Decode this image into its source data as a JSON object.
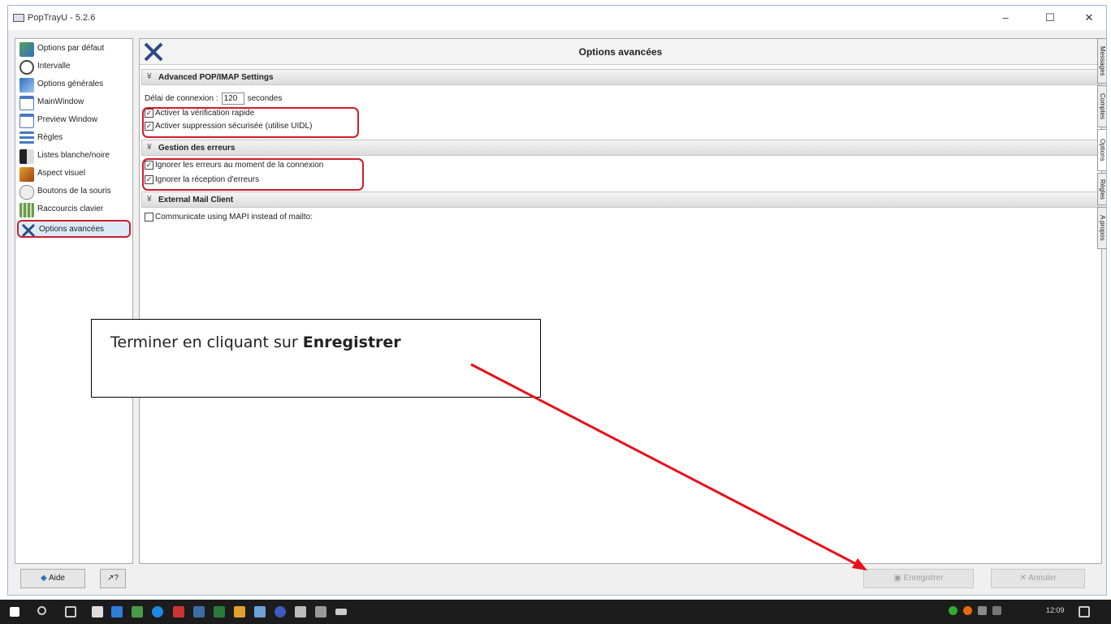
{
  "window": {
    "title": "PopTrayU - 5.2.6",
    "minimize": "–",
    "maximize": "☐",
    "close": "✕"
  },
  "sidebar": {
    "items": [
      {
        "label": "Options par défaut",
        "icon": "user-options-icon",
        "color": "#3a7a3a"
      },
      {
        "label": "Intervalle",
        "icon": "clock-icon",
        "color": "#555"
      },
      {
        "label": "Options générales",
        "icon": "users-icon",
        "color": "#2f6fc0"
      },
      {
        "label": "MainWindow",
        "icon": "window-icon",
        "color": "#4a78c2"
      },
      {
        "label": "Preview Window",
        "icon": "preview-window-icon",
        "color": "#4a78c2"
      },
      {
        "label": "Règles",
        "icon": "rules-icon",
        "color": "#4a78c2"
      },
      {
        "label": "Listes blanche/noire",
        "icon": "black-white-list-icon",
        "color": "#333"
      },
      {
        "label": "Aspect visuel",
        "icon": "paint-icon",
        "color": "#c07020"
      },
      {
        "label": "Boutons de la souris",
        "icon": "mouse-icon",
        "color": "#888"
      },
      {
        "label": "Raccourcis clavier",
        "icon": "keyboard-icon",
        "color": "#4a8a3a"
      },
      {
        "label": "Options avancées",
        "icon": "tools-icon",
        "color": "#2a4a8a"
      }
    ]
  },
  "main": {
    "title": "Options avancées",
    "sections": [
      {
        "title": "Advanced POP/IMAP Settings"
      },
      {
        "title": "Gestion des erreurs"
      },
      {
        "title": "External Mail Client"
      }
    ],
    "delay": {
      "label": "Délai de connexion :",
      "value": "120",
      "unit": "secondes"
    },
    "checkboxes": {
      "fast_check": {
        "label": "Activer la vérification rapide",
        "checked": true
      },
      "safe_delete": {
        "label": "Activer suppression sécurisée (utilise UIDL)",
        "checked": true
      },
      "ignore_conn_errors": {
        "label": "Ignorer les erreurs au moment de la connexion",
        "checked": true
      },
      "ignore_recv_errors": {
        "label": "Ignorer la réception d'erreurs",
        "checked": true
      },
      "mapi": {
        "label": "Communicate using MAPI instead of mailto:",
        "checked": false
      }
    }
  },
  "right_tabs": [
    "Messages",
    "Comptes",
    "Options",
    "Règles",
    "A propos"
  ],
  "callout": {
    "text": "Terminer en cliquant sur ",
    "bold": "Enregistrer"
  },
  "footer": {
    "help": "Aide",
    "whatsthis": "↗?",
    "save": "Enregistrer",
    "cancel": "Annuler"
  },
  "taskbar": {
    "time": "12:09"
  },
  "colors": {
    "highlight": "#d01c2a",
    "arrow": "#e8101a",
    "taskbar": "#1c1c1c"
  }
}
